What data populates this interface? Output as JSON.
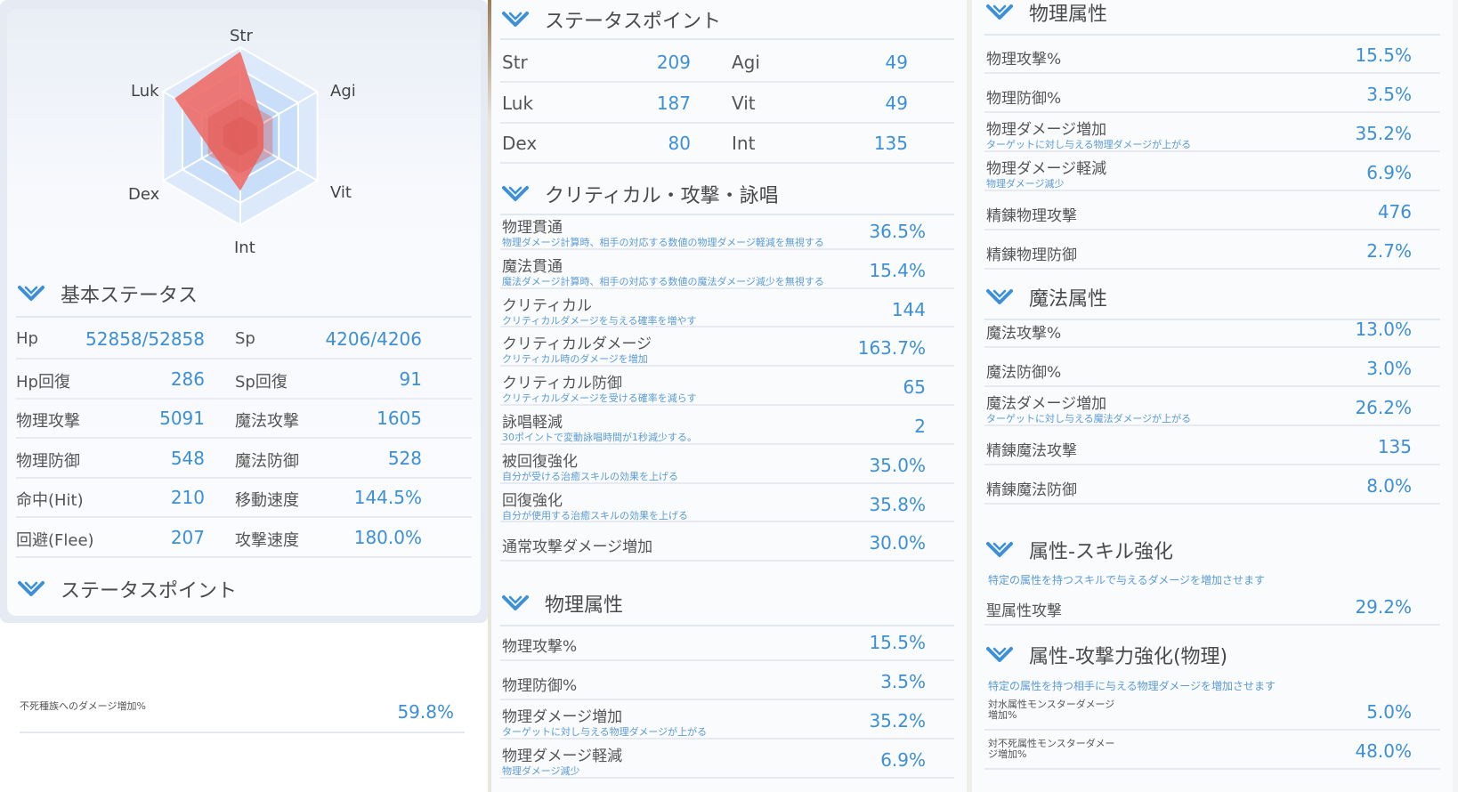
{
  "radar": {
    "labels": {
      "str": "Str",
      "agi": "Agi",
      "vit": "Vit",
      "int": "Int",
      "dex": "Dex",
      "luk": "Luk"
    },
    "values": {
      "str": 209,
      "agi": 49,
      "vit": 49,
      "int": 135,
      "dex": 80,
      "luk": 187
    },
    "max": 220,
    "fill_color": "#ee6f6a",
    "web_color": "#bcd6f5"
  },
  "basic": {
    "header": "基本ステータス",
    "rows": [
      {
        "l1": "Hp",
        "v1": "52858/52858",
        "l2": "Sp",
        "v2": "4206/4206"
      },
      {
        "l1": "Hp回復",
        "v1": "286",
        "l2": "Sp回復",
        "v2": "91"
      },
      {
        "l1": "物理攻撃",
        "v1": "5091",
        "l2": "魔法攻撃",
        "v2": "1605"
      },
      {
        "l1": "物理防御",
        "v1": "548",
        "l2": "魔法防御",
        "v2": "528"
      },
      {
        "l1": "命中(Hit)",
        "v1": "210",
        "l2": "移動速度",
        "v2": "144.5%"
      },
      {
        "l1": "回避(Flee)",
        "v1": "207",
        "l2": "攻撃速度",
        "v2": "180.0%"
      }
    ]
  },
  "status_points_header_left": "ステータスポイント",
  "undead": {
    "label": "不死種族へのダメージ増加%",
    "value": "59.8%"
  },
  "status_points": {
    "header": "ステータスポイント",
    "rows": [
      {
        "l1": "Str",
        "v1": "209",
        "l2": "Agi",
        "v2": "49"
      },
      {
        "l1": "Luk",
        "v1": "187",
        "l2": "Vit",
        "v2": "49"
      },
      {
        "l1": "Dex",
        "v1": "80",
        "l2": "Int",
        "v2": "135"
      }
    ]
  },
  "critical": {
    "header": "クリティカル・攻撃・詠唱",
    "rows": [
      {
        "label": "物理貫通",
        "sub": "物理ダメージ計算時、相手の対応する数値の物理ダメージ軽減を無視する",
        "value": "36.5%"
      },
      {
        "label": "魔法貫通",
        "sub": "魔法ダメージ計算時、相手の対応する数値の魔法ダメージ減少を無視する",
        "value": "15.4%"
      },
      {
        "label": "クリティカル",
        "sub": "クリティカルダメージを与える確率を増やす",
        "value": "144"
      },
      {
        "label": "クリティカルダメージ",
        "sub": "クリティカル時のダメージを増加",
        "value": "163.7%"
      },
      {
        "label": "クリティカル防御",
        "sub": "クリティカルダメージを受ける確率を減らす",
        "value": "65"
      },
      {
        "label": "詠唱軽減",
        "sub": "30ポイントで変動詠唱時間が1秒減少する。",
        "value": "2"
      },
      {
        "label": "被回復強化",
        "sub": "自分が受ける治癒スキルの効果を上げる",
        "value": "35.0%"
      },
      {
        "label": "回復強化",
        "sub": "自分が使用する治癒スキルの効果を上げる",
        "value": "35.8%"
      },
      {
        "label": "通常攻撃ダメージ増加",
        "sub": "",
        "value": "30.0%"
      }
    ]
  },
  "phys_mid": {
    "header": "物理属性",
    "rows": [
      {
        "label": "物理攻撃%",
        "sub": "",
        "value": "15.5%"
      },
      {
        "label": "物理防御%",
        "sub": "",
        "value": "3.5%"
      },
      {
        "label": "物理ダメージ増加",
        "sub": "ターゲットに対し与える物理ダメージが上がる",
        "value": "35.2%"
      },
      {
        "label": "物理ダメージ軽減",
        "sub": "物理ダメージ減少",
        "value": "6.9%"
      }
    ]
  },
  "phys_right": {
    "header": "物理属性",
    "rows": [
      {
        "label": "物理攻撃%",
        "sub": "",
        "value": "15.5%"
      },
      {
        "label": "物理防御%",
        "sub": "",
        "value": "3.5%"
      },
      {
        "label": "物理ダメージ増加",
        "sub": "ターゲットに対し与える物理ダメージが上がる",
        "value": "35.2%"
      },
      {
        "label": "物理ダメージ軽減",
        "sub": "物理ダメージ減少",
        "value": "6.9%"
      },
      {
        "label": "精錬物理攻撃",
        "sub": "",
        "value": "476"
      },
      {
        "label": "精錬物理防御",
        "sub": "",
        "value": "2.7%"
      }
    ]
  },
  "magic": {
    "header": "魔法属性",
    "rows": [
      {
        "label": "魔法攻撃%",
        "sub": "",
        "value": "13.0%"
      },
      {
        "label": "魔法防御%",
        "sub": "",
        "value": "3.0%"
      },
      {
        "label": "魔法ダメージ増加",
        "sub": "ターゲットに対し与える魔法ダメージが上がる",
        "value": "26.2%"
      },
      {
        "label": "精錬魔法攻撃",
        "sub": "",
        "value": "135"
      },
      {
        "label": "精錬魔法防御",
        "sub": "",
        "value": "8.0%"
      }
    ]
  },
  "elem_skill": {
    "header": "属性-スキル強化",
    "note": "特定の属性を持つスキルで与えるダメージを増加させます",
    "rows": [
      {
        "label": "聖属性攻撃",
        "value": "29.2%"
      }
    ]
  },
  "elem_atk": {
    "header": "属性-攻撃力強化(物理)",
    "note": "特定の属性を持つ相手に与える物理ダメージを増加させます",
    "rows": [
      {
        "label": "対水属性モンスターダメージ増加%",
        "value": "5.0%"
      },
      {
        "label": "対不死属性モンスターダメージ増加%",
        "value": "48.0%"
      }
    ]
  },
  "colors": {
    "accent": "#3d8fd6",
    "chevron": "#3d8fd6",
    "text": "#555555"
  }
}
